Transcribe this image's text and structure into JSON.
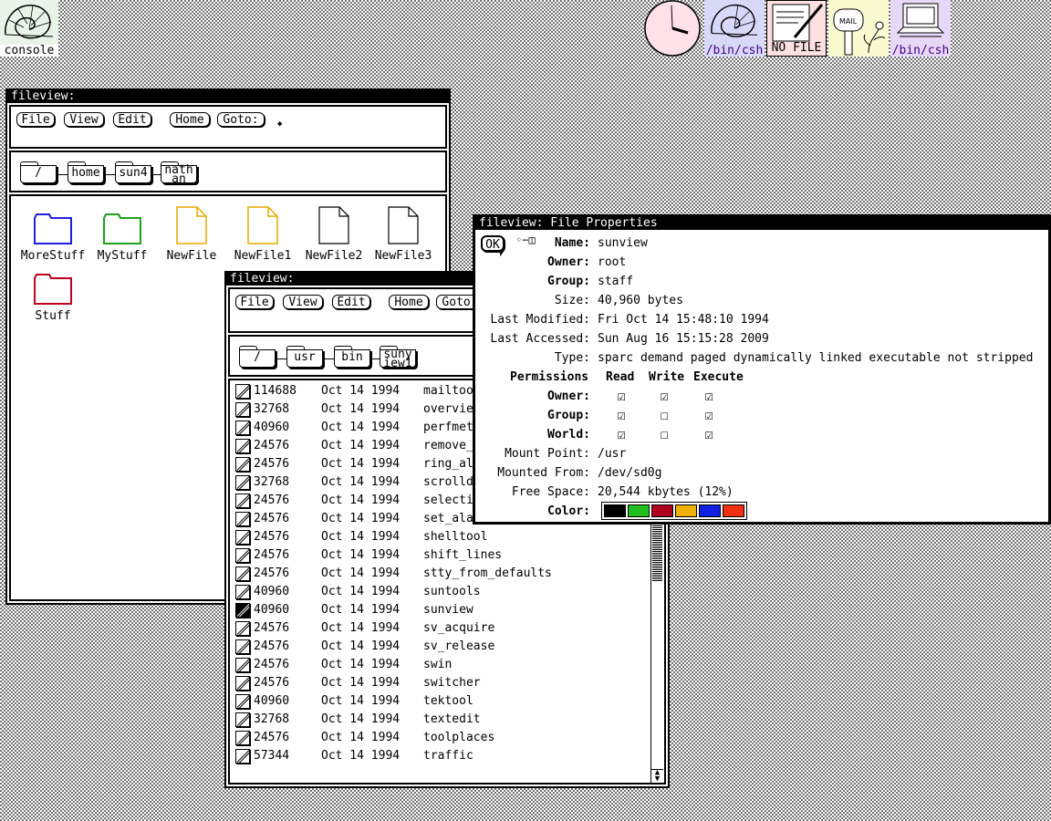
{
  "desktop": {
    "console_label": "console",
    "bin_csh_label_1": "/bin/csh",
    "notepad_label": "NO FILE",
    "mail_label": "MAIL",
    "bin_csh_label_2": "/bin/csh"
  },
  "fileview1": {
    "title": "fileview:",
    "menu": {
      "file": "File",
      "view": "View",
      "edit": "Edit",
      "home": "Home",
      "goto": "Goto:"
    },
    "path": [
      "/",
      "home",
      "sun4",
      "nath\nan"
    ],
    "items": [
      {
        "label": "MoreStuff",
        "color": "#2020e0"
      },
      {
        "label": "MyStuff",
        "color": "#20a020"
      },
      {
        "label": "NewFile",
        "color": "#e8a800"
      },
      {
        "label": "NewFile1",
        "color": "#e8a800"
      },
      {
        "label": "NewFile2",
        "color": "#000000"
      },
      {
        "label": "NewFile3",
        "color": "#000000"
      },
      {
        "label": "Stuff",
        "color": "#c00020"
      }
    ]
  },
  "fileview2": {
    "title": "fileview:",
    "menu": {
      "file": "File",
      "view": "View",
      "edit": "Edit",
      "home": "Home",
      "goto": "Goto:"
    },
    "path": [
      "/",
      "usr",
      "bin",
      "suny\niew1"
    ],
    "rows": [
      {
        "size": "114688",
        "date": "Oct 14 1994",
        "name": "mailtool"
      },
      {
        "size": "32768",
        "date": "Oct 14 1994",
        "name": "overview"
      },
      {
        "size": "40960",
        "date": "Oct 14 1994",
        "name": "perfmeter"
      },
      {
        "size": "24576",
        "date": "Oct 14 1994",
        "name": "remove_brackets"
      },
      {
        "size": "24576",
        "date": "Oct 14 1994",
        "name": "ring_alarm"
      },
      {
        "size": "32768",
        "date": "Oct 14 1994",
        "name": "scrolldefaults"
      },
      {
        "size": "24576",
        "date": "Oct 14 1994",
        "name": "selection_svc"
      },
      {
        "size": "24576",
        "date": "Oct 14 1994",
        "name": "set_alarm"
      },
      {
        "size": "24576",
        "date": "Oct 14 1994",
        "name": "shelltool"
      },
      {
        "size": "24576",
        "date": "Oct 14 1994",
        "name": "shift_lines"
      },
      {
        "size": "24576",
        "date": "Oct 14 1994",
        "name": "stty_from_defaults"
      },
      {
        "size": "40960",
        "date": "Oct 14 1994",
        "name": "suntools"
      },
      {
        "size": "40960",
        "date": "Oct 14 1994",
        "name": "sunview",
        "selected": true
      },
      {
        "size": "24576",
        "date": "Oct 14 1994",
        "name": "sv_acquire"
      },
      {
        "size": "24576",
        "date": "Oct 14 1994",
        "name": "sv_release"
      },
      {
        "size": "24576",
        "date": "Oct 14 1994",
        "name": "swin"
      },
      {
        "size": "24576",
        "date": "Oct 14 1994",
        "name": "switcher"
      },
      {
        "size": "40960",
        "date": "Oct 14 1994",
        "name": "tektool"
      },
      {
        "size": "32768",
        "date": "Oct 14 1994",
        "name": "textedit"
      },
      {
        "size": "24576",
        "date": "Oct 14 1994",
        "name": "toolplaces"
      },
      {
        "size": "57344",
        "date": "Oct 14 1994",
        "name": "traffic"
      }
    ]
  },
  "props": {
    "title": "fileview: File Properties",
    "ok_label": "OK",
    "name_key": "Name:",
    "name_val": "sunview",
    "owner_key": "Owner:",
    "owner_val": "root",
    "group_key": "Group:",
    "group_val": "staff",
    "size_key": "Size:",
    "size_val": "40,960 bytes",
    "modified_key": "Last Modified:",
    "modified_val": "Fri Oct 14 15:48:10 1994",
    "accessed_key": "Last Accessed:",
    "accessed_val": "Sun Aug 16 15:15:28 2009",
    "type_key": "Type:",
    "type_val": "sparc demand paged dynamically linked executable not stripped",
    "perm_header": "Permissions",
    "perm_read": "Read",
    "perm_write": "Write",
    "perm_exec": "Execute",
    "perm_owner": "Owner:",
    "perm_group": "Group:",
    "perm_world": "World:",
    "perms": {
      "owner": [
        true,
        true,
        true
      ],
      "group": [
        true,
        false,
        true
      ],
      "world": [
        true,
        false,
        true
      ]
    },
    "mount_key": "Mount Point:",
    "mount_val": "/usr",
    "mounted_key": "Mounted From:",
    "mounted_val": "/dev/sd0g",
    "free_key": "Free Space:",
    "free_val": "20,544 kbytes (12%)",
    "color_key": "Color:",
    "colors": [
      "#000000",
      "#20c020",
      "#b00020",
      "#f0b000",
      "#1020e0",
      "#f03010"
    ]
  }
}
